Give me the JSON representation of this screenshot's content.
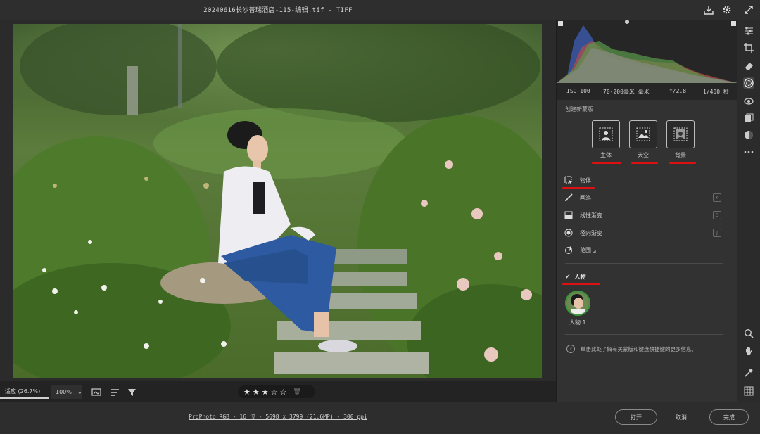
{
  "window": {
    "title": "20240616长沙普瑞酒店-115-编辑.tif -  TIFF"
  },
  "zoom": {
    "fit_label": "适应 (26.7%)",
    "pct_label": "100%",
    "caret": "⌄"
  },
  "rating": {
    "stars": [
      "★",
      "★",
      "★",
      "☆",
      "☆"
    ],
    "filled": 3,
    "trash": "🗑"
  },
  "status": {
    "color_info": "ProPhoto RGB - 16 位 - 5698 x 3799 (21.6MP) - 300 ppi"
  },
  "buttons": {
    "open": "打开",
    "cancel": "取消",
    "done": "完成"
  },
  "exif": {
    "iso": "ISO 100",
    "lens": "70-200毫米 毫米",
    "aperture": "f/2.8",
    "shutter": "1/400 秒"
  },
  "masks": {
    "section_title": "创建新蒙版",
    "subject": "主体",
    "sky": "天空",
    "background": "背景",
    "tools": [
      {
        "label": "物体",
        "key": ""
      },
      {
        "label": "画笔",
        "key": "K"
      },
      {
        "label": "线性渐变",
        "key": "G"
      },
      {
        "label": "径向渐变",
        "key": "J"
      },
      {
        "label": "范围",
        "key": ""
      }
    ],
    "people_heading": "人物",
    "person_label": "人物 1",
    "help_text": "单击此处了解有关蒙版和键盘快捷键的更多信息。"
  },
  "colors": {
    "accent_red": "#d11111",
    "panel_bg": "#323232",
    "app_bg": "#2b2b2b"
  },
  "icons": [
    "export-icon",
    "gear-icon",
    "expand-icon",
    "edit-sliders-icon",
    "crop-icon",
    "eraser-icon",
    "masking-icon",
    "redeye-icon",
    "presets-icon",
    "color-icon",
    "more-icon",
    "zoom-icon",
    "hand-icon",
    "eyedropper-icon",
    "grid-icon"
  ]
}
